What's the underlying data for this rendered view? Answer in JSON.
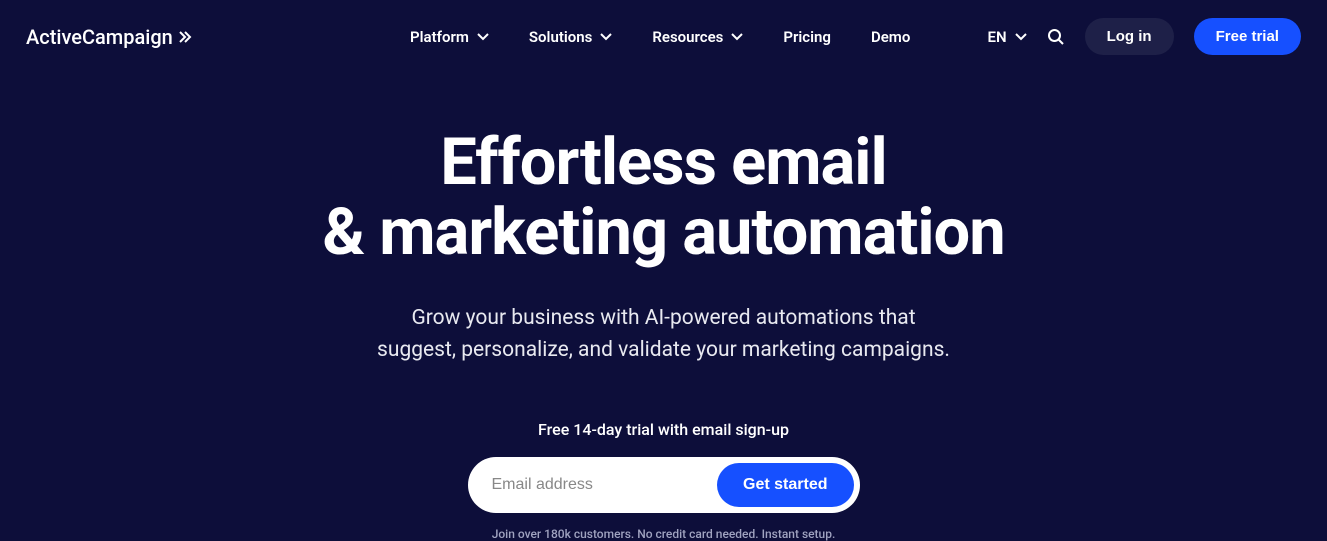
{
  "brand": "ActiveCampaign",
  "nav": {
    "platform": "Platform",
    "solutions": "Solutions",
    "resources": "Resources",
    "pricing": "Pricing",
    "demo": "Demo"
  },
  "header": {
    "language": "EN",
    "login": "Log in",
    "trial": "Free trial"
  },
  "hero": {
    "title_line1": "Effortless email",
    "title_line2": "& marketing automation",
    "subtitle_line1": "Grow your business with AI-powered automations that",
    "subtitle_line2": "suggest, personalize, and validate your marketing campaigns.",
    "trial_label": "Free 14-day trial with email sign-up",
    "email_placeholder": "Email address",
    "cta": "Get started",
    "fine_print": "Join over 180k customers. No credit card needed. Instant setup."
  }
}
